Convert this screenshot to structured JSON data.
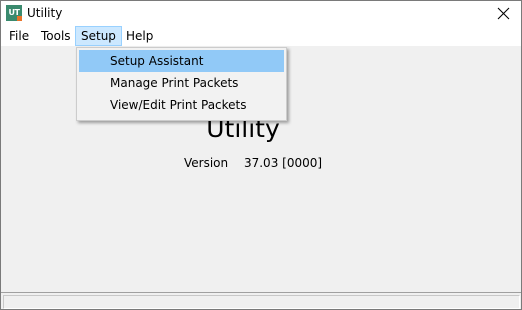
{
  "window": {
    "title": "Utility",
    "icon_text": "UT"
  },
  "menubar": {
    "items": [
      {
        "label": "File"
      },
      {
        "label": "Tools"
      },
      {
        "label": "Setup"
      },
      {
        "label": "Help"
      }
    ],
    "active": "Setup"
  },
  "setup_menu": {
    "items": [
      {
        "label": "Setup Assistant",
        "highlighted": true
      },
      {
        "label": "Manage Print Packets",
        "highlighted": false
      },
      {
        "label": "View/Edit Print Packets",
        "highlighted": false
      }
    ]
  },
  "about": {
    "app_name": "Utility",
    "version_label": "Version",
    "version_value": "37.03 [0000]"
  },
  "colors": {
    "menu_active_bg": "#cce8ff",
    "menu_highlight_bg": "#91c9f7",
    "icon_bg": "#3a8a6e",
    "icon_accent": "#e8742a"
  },
  "icons": {
    "app": "utility-app-icon",
    "close": "close-icon"
  }
}
